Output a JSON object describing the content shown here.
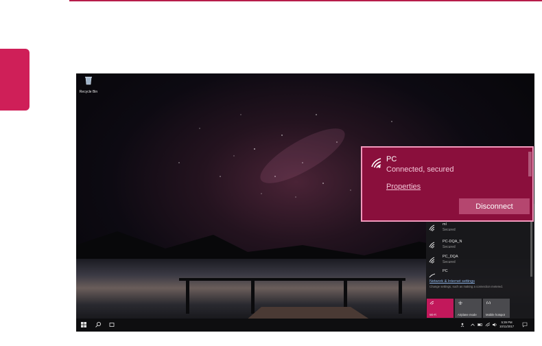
{
  "desktop": {
    "icons": [
      {
        "label": "Recycle Bin",
        "icon": "recycle-bin-icon"
      }
    ]
  },
  "flyout": {
    "networks": [
      {
        "name": "ml",
        "status": "Secured",
        "icon": "wifi-icon"
      },
      {
        "name": "PC-DQA_N",
        "status": "Secured",
        "icon": "wifi-icon"
      },
      {
        "name": "PC_DQA",
        "status": "Secured",
        "icon": "wifi-icon"
      },
      {
        "name": "PC",
        "status": "",
        "icon": "wifi-icon"
      }
    ],
    "settings_link": "Network & Internet settings",
    "settings_desc": "Change settings, such as making a connection metered.",
    "tiles": [
      {
        "label": "Wi-Fi",
        "icon": "wifi-icon",
        "active": true
      },
      {
        "label": "Airplane mode",
        "icon": "airplane-icon",
        "active": false
      },
      {
        "label": "Mobile hotspot",
        "icon": "hotspot-icon",
        "active": false
      }
    ]
  },
  "connected_network": {
    "name": "PC",
    "status": "Connected, secured",
    "properties_label": "Properties",
    "disconnect_label": "Disconnect"
  },
  "taskbar": {
    "time": "5:39 PM",
    "date": "10/11/2017"
  },
  "colors": {
    "accent": "#cf1f58",
    "highlight_panel": "#8a0f3c",
    "highlight_border": "#f29abd",
    "active_tile": "#c2185b"
  }
}
